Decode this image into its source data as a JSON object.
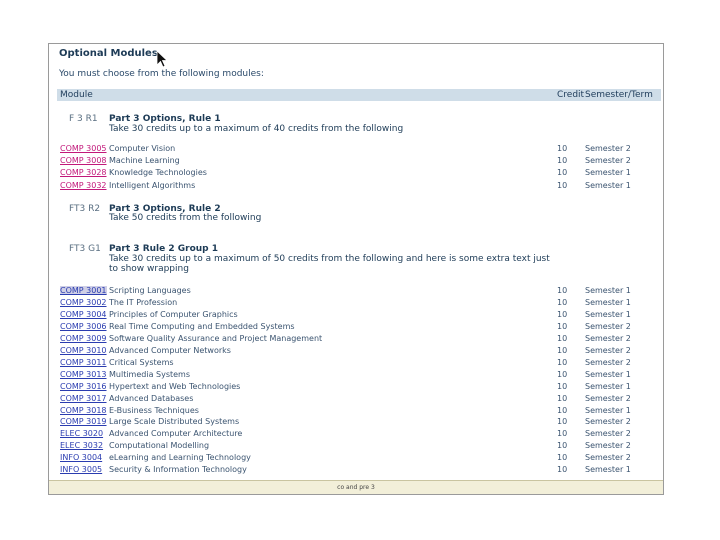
{
  "page": {
    "title": "Optional Modules",
    "intro": "You must choose from the following modules:"
  },
  "table_header": {
    "module": "Module",
    "credit": "Credit",
    "semester": "Semester/Term"
  },
  "rules": [
    {
      "code": "F 3 R1",
      "title": "Part 3 Options, Rule 1",
      "desc": "Take 30 credits up to a maximum of 40 credits from the following"
    },
    {
      "code": "FT3 R2",
      "title": "Part 3 Options, Rule 2",
      "desc": "Take 50 credits from the following"
    },
    {
      "code": "FT3 G1",
      "title": "Part 3 Rule 2 Group 1",
      "desc": "Take 30 credits up to a maximum of 50 credits from the following and here is some extra text just to show wrapping"
    }
  ],
  "group1_modules": [
    {
      "code": "COMP 3005",
      "name": "Computer Vision",
      "credit": "10",
      "semester": "Semester 2"
    },
    {
      "code": "COMP 3008",
      "name": "Machine Learning",
      "credit": "10",
      "semester": "Semester 2"
    },
    {
      "code": "COMP 3028",
      "name": "Knowledge Technologies",
      "credit": "10",
      "semester": "Semester 1"
    },
    {
      "code": "COMP 3032",
      "name": "Intelligent Algorithms",
      "credit": "10",
      "semester": "Semester 1"
    }
  ],
  "group3_modules": [
    {
      "code": "COMP 3001",
      "name": "Scripting Languages",
      "credit": "10",
      "semester": "Semester 1"
    },
    {
      "code": "COMP 3002",
      "name": "The IT Profession",
      "credit": "10",
      "semester": "Semester 1"
    },
    {
      "code": "COMP 3004",
      "name": "Principles of Computer Graphics",
      "credit": "10",
      "semester": "Semester 1"
    },
    {
      "code": "COMP 3006",
      "name": "Real Time Computing and Embedded Systems",
      "credit": "10",
      "semester": "Semester 2"
    },
    {
      "code": "COMP 3009",
      "name": "Software Quality Assurance and Project Management",
      "credit": "10",
      "semester": "Semester 2"
    },
    {
      "code": "COMP 3010",
      "name": "Advanced Computer Networks",
      "credit": "10",
      "semester": "Semester 2"
    },
    {
      "code": "COMP 3011",
      "name": "Critical Systems",
      "credit": "10",
      "semester": "Semester 2"
    },
    {
      "code": "COMP 3013",
      "name": "Multimedia Systems",
      "credit": "10",
      "semester": "Semester 1"
    },
    {
      "code": "COMP 3016",
      "name": "Hypertext and Web Technologies",
      "credit": "10",
      "semester": "Semester 1"
    },
    {
      "code": "COMP 3017",
      "name": "Advanced Databases",
      "credit": "10",
      "semester": "Semester 2"
    },
    {
      "code": "COMP 3018",
      "name": "E-Business Techniques",
      "credit": "10",
      "semester": "Semester 1"
    },
    {
      "code": "COMP 3019",
      "name": "Large Scale Distributed Systems",
      "credit": "10",
      "semester": "Semester 2"
    },
    {
      "code": "ELEC 3020",
      "name": "Advanced Computer Architecture",
      "credit": "10",
      "semester": "Semester 2"
    },
    {
      "code": "ELEC 3032",
      "name": "Computational Modelling",
      "credit": "10",
      "semester": "Semester 2"
    },
    {
      "code": "INFO 3004",
      "name": "eLearning and Learning Technology",
      "credit": "10",
      "semester": "Semester 2"
    },
    {
      "code": "INFO 3005",
      "name": "Security & Information Technology",
      "credit": "10",
      "semester": "Semester 1"
    }
  ],
  "footer": "co and pre 3",
  "colors": {
    "link_pink": "#c2187a",
    "link_blue": "#2a3cb0",
    "header_bg": "#cfdde8",
    "footer_bg": "#f2efd9"
  },
  "icons": {
    "cursor": "arrow-cursor-icon"
  }
}
